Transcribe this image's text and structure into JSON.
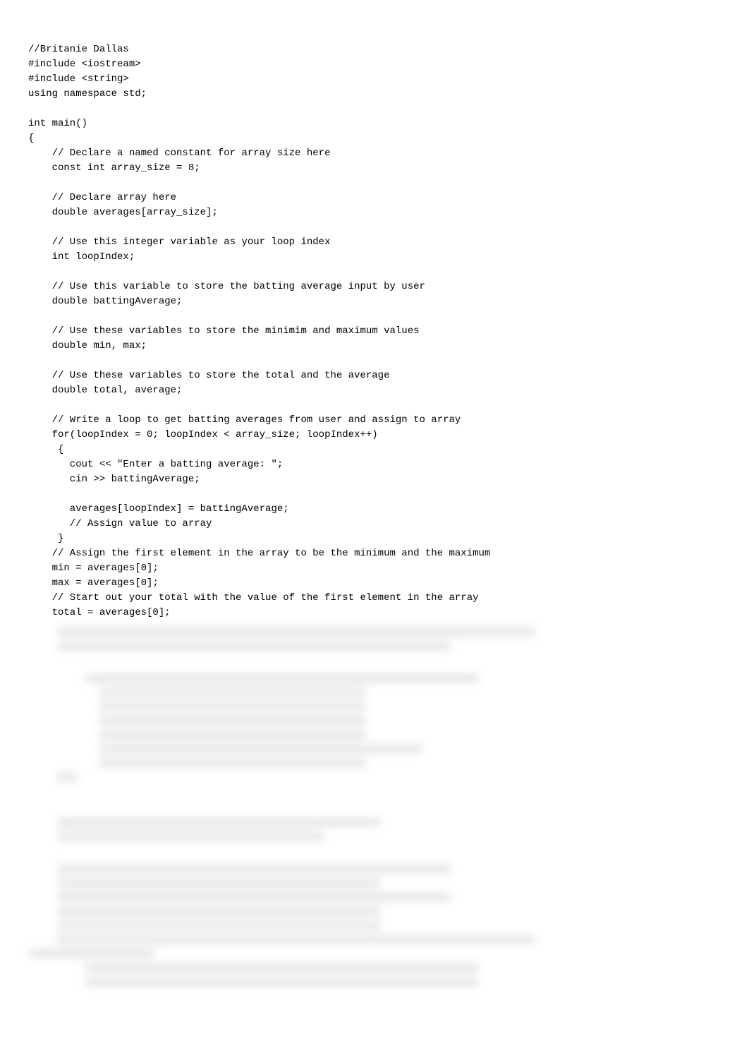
{
  "code": {
    "lines": [
      "//Britanie Dallas",
      "#include <iostream>",
      "#include <string>",
      "using namespace std;",
      "",
      "int main()",
      "{",
      "    // Declare a named constant for array size here",
      "    const int array_size = 8;",
      "",
      "    // Declare array here",
      "    double averages[array_size];",
      "",
      "    // Use this integer variable as your loop index",
      "    int loopIndex;",
      "",
      "    // Use this variable to store the batting average input by user",
      "    double battingAverage;",
      "",
      "    // Use these variables to store the minimim and maximum values",
      "    double min, max;",
      "",
      "    // Use these variables to store the total and the average",
      "    double total, average;",
      "",
      "    // Write a loop to get batting averages from user and assign to array",
      "    for(loopIndex = 0; loopIndex < array_size; loopIndex++)",
      "     {",
      "       cout << \"Enter a batting average: \";",
      "       cin >> battingAverage;",
      "",
      "       averages[loopIndex] = battingAverage;",
      "       // Assign value to array",
      "     }",
      "    // Assign the first element in the array to be the minimum and the maximum",
      "    min = averages[0];",
      "    max = averages[0];",
      "    // Start out your total with the value of the first element in the array",
      "    total = averages[0];"
    ]
  }
}
